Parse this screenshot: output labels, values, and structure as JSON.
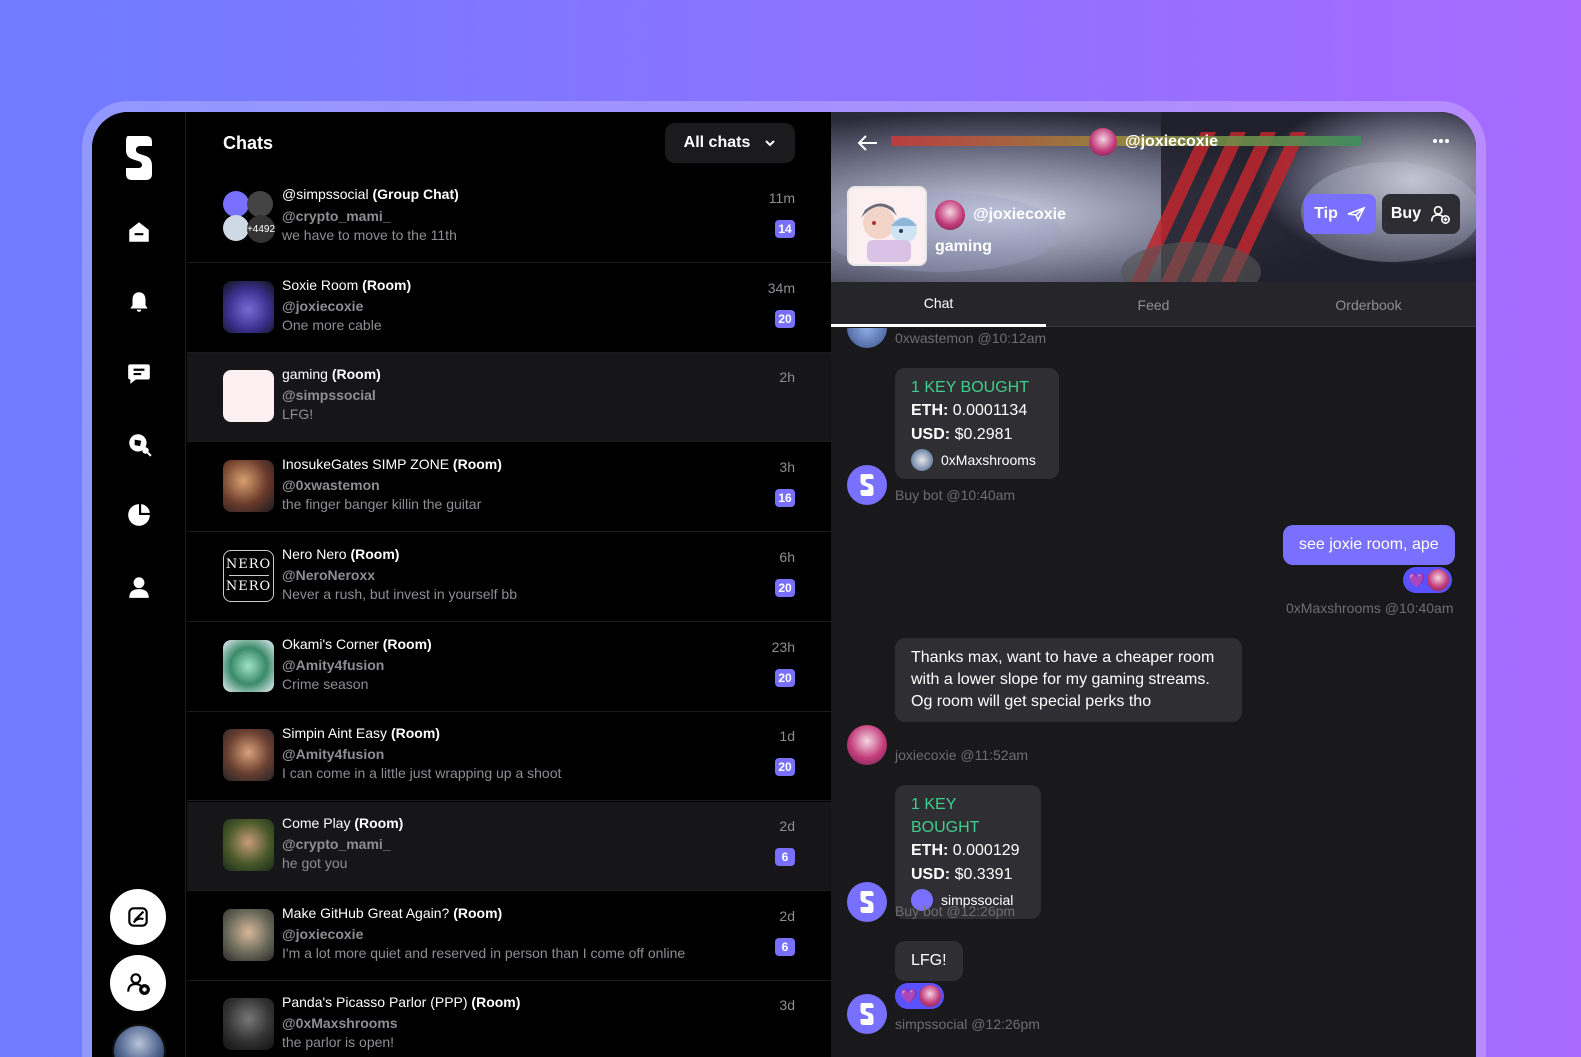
{
  "nav": {
    "icons": [
      "logo-icon",
      "home-icon",
      "bell-icon",
      "chat-icon",
      "explore-icon",
      "portfolio-icon",
      "profile-icon"
    ],
    "compose_icon": "compose-icon",
    "add_user_icon": "add-user-icon"
  },
  "list": {
    "title": "Chats",
    "filter": "All chats",
    "rows": [
      {
        "name": "@simpssocial",
        "kind": "(Group Chat)",
        "handle": "@crypto_mami_",
        "message": "we have to move to the 11th",
        "time": "11m",
        "badge": "14",
        "extra": "+4492"
      },
      {
        "name": "Soxie Room",
        "kind": "(Room)",
        "handle": "@joxiecoxie",
        "message": "One more cable",
        "time": "34m",
        "badge": "20"
      },
      {
        "name": "gaming",
        "kind": "(Room)",
        "handle": "@simpssocial",
        "message": "LFG!",
        "time": "2h",
        "badge": ""
      },
      {
        "name": "InosukeGates SIMP ZONE",
        "kind": "(Room)",
        "handle": "@0xwastemon",
        "message": "the finger banger killin the guitar",
        "time": "3h",
        "badge": "16"
      },
      {
        "name": "Nero Nero",
        "kind": "(Room)",
        "handle": "@NeroNeroxx",
        "message": "Never a rush, but invest in yourself bb",
        "time": "6h",
        "badge": "20",
        "avatar_text": "NERO"
      },
      {
        "name": "Okami's Corner",
        "kind": "(Room)",
        "handle": "@Amity4fusion",
        "message": "Crime season",
        "time": "23h",
        "badge": "20"
      },
      {
        "name": "Simpin Aint Easy",
        "kind": "(Room)",
        "handle": "@Amity4fusion",
        "message": "I can come in a little just wrapping up a shoot",
        "time": "1d",
        "badge": "20"
      },
      {
        "name": "Come Play ",
        "kind": "(Room)",
        "handle": "@crypto_mami_",
        "message": "he got you",
        "time": "2d",
        "badge": "6"
      },
      {
        "name": "Make GitHub Great Again?",
        "kind": "(Room)",
        "handle": "@joxiecoxie",
        "message": "I'm a lot more quiet and reserved in person than I come off online",
        "time": "2d",
        "badge": "6"
      },
      {
        "name": "Panda's Picasso Parlor (PPP) ",
        "kind": "(Room)",
        "handle": "@0xMaxshrooms",
        "message": "the parlor is open!",
        "time": "3d",
        "badge": ""
      }
    ]
  },
  "room": {
    "header_handle": "@joxiecoxie",
    "owner_handle": "@joxiecoxie",
    "room_name": "gaming",
    "tip_label": "Tip",
    "buy_label": "Buy",
    "tabs": [
      "Chat",
      "Feed",
      "Orderbook"
    ],
    "active_tab": "Chat"
  },
  "messages": {
    "m0_meta": "0xwastemon @10:12am",
    "k1": {
      "title": "1 KEY BOUGHT",
      "eth_label": "ETH:",
      "eth": "0.0001134",
      "usd_label": "USD:",
      "usd": "$0.2981",
      "user": "0xMaxshrooms",
      "meta": "Buy bot @10:40am"
    },
    "out1": {
      "text": "see joxie room, ape",
      "meta": "0xMaxshrooms @10:40am"
    },
    "in1": {
      "text": "Thanks max, want to have a cheaper room with a lower slope for my gaming streams. Og room will get special perks tho",
      "meta": "joxiecoxie @11:52am"
    },
    "k2": {
      "title": "1 KEY BOUGHT",
      "eth_label": "ETH:",
      "eth": "0.000129",
      "usd_label": "USD:",
      "usd": "$0.3391",
      "user": "simpssocial",
      "meta": "Buy bot @12:26pm"
    },
    "in2": {
      "text": "LFG!",
      "meta": "simpssocial @12:26pm"
    }
  },
  "colors": {
    "accent": "#7a70ff",
    "key_green": "#3ecf8e",
    "bg_gradient_start": "#6f7cff",
    "bg_gradient_end": "#a86aff"
  }
}
